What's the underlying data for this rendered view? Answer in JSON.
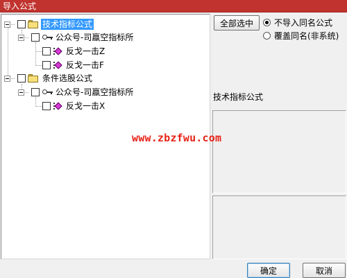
{
  "window": {
    "title": "导入公式"
  },
  "tree": {
    "groups": [
      {
        "label": "技术指标公式",
        "selected": true,
        "children": [
          {
            "label": "公众号-司蠃空指标所",
            "items": [
              {
                "label": "反戈一击Z"
              },
              {
                "label": "反戈一击F"
              }
            ]
          }
        ]
      },
      {
        "label": "条件选股公式",
        "selected": false,
        "children": [
          {
            "label": "公众号-司蠃空指标所",
            "items": [
              {
                "label": "反戈一击X"
              }
            ]
          }
        ]
      }
    ]
  },
  "controls": {
    "select_all_label": "全部选中",
    "radio_options": [
      {
        "label": "不导入同名公式",
        "checked": true
      },
      {
        "label": "覆盖同名(非系统)",
        "checked": false
      }
    ],
    "section_label": "技术指标公式"
  },
  "footer": {
    "ok_label": "确定",
    "cancel_label": "取消"
  },
  "watermark": {
    "text": "www.zbzfwu.com",
    "color": "#e8241a"
  },
  "colors": {
    "titlebar": "#c0332e",
    "selection": "#3399ff",
    "formula_icon": "#d83ad8",
    "folder": "#f7e07a"
  }
}
